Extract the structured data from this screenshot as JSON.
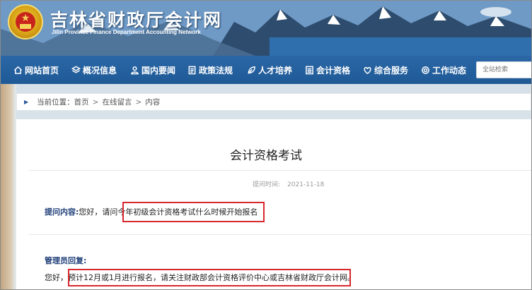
{
  "header": {
    "title": "吉林省财政厅会计网",
    "subtitle": "Jilin Province Finance Department Accounting Network"
  },
  "nav": {
    "items": [
      {
        "label": "网站首页",
        "icon": "home-icon"
      },
      {
        "label": "概况信息",
        "icon": "layers-icon"
      },
      {
        "label": "国内要闻",
        "icon": "person-icon"
      },
      {
        "label": "政策法规",
        "icon": "document-icon"
      },
      {
        "label": "人才培养",
        "icon": "leaf-icon"
      },
      {
        "label": "会计资格",
        "icon": "list-icon"
      },
      {
        "label": "综合服务",
        "icon": "heart-icon"
      },
      {
        "label": "工作动态",
        "icon": "gear-icon"
      }
    ],
    "search_placeholder": "全站检索"
  },
  "breadcrumb": {
    "prefix": "当前位置：",
    "items": [
      "首页",
      "在线留言",
      "内容"
    ],
    "separator": ">"
  },
  "article": {
    "title": "会计资格考试",
    "date_label": "提问时间:",
    "date": "2021-11-18"
  },
  "question": {
    "label": "提问内容:",
    "text_plain": "您好，请问",
    "text_highlight": "今年初级会计资格考试什么时候开始报名"
  },
  "answer": {
    "label": "管理员回复:",
    "text_plain": "您好，",
    "text_highlight": "预计12月或1月进行报名，请关注财政部会计资格评价中心或吉林省财政厅会计网。"
  },
  "colors": {
    "nav_bg": "#1f5a97",
    "highlight_border": "#d9272e",
    "label_blue": "#1f3f78"
  }
}
